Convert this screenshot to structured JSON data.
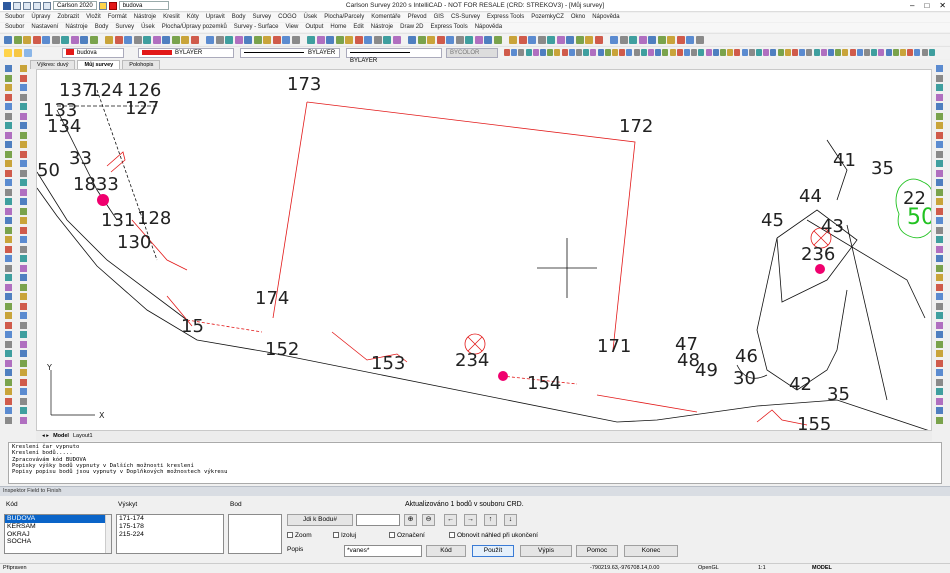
{
  "title": "Carlson Survey 2020 s IntelliCAD - NOT FOR RESALE (CRD: STREKOV3) - [Můj survey]",
  "quick_access": {
    "profile": "Carlson 2020",
    "layer": "budova"
  },
  "menu1": [
    "Soubor",
    "Úpravy",
    "Zobrazit",
    "Vložit",
    "Formát",
    "Nástroje",
    "Kreslit",
    "Kóty",
    "Upravit",
    "Body",
    "Survey",
    "COGO",
    "Úsek",
    "Plocha/Parcely",
    "Komentáře",
    "Převod",
    "GIS",
    "CS-Survey",
    "Express Tools",
    "PozemkyCZ",
    "Okno",
    "Nápověda"
  ],
  "menu2": [
    "Soubor",
    "Nastavení",
    "Nástroje",
    "Body",
    "Survey",
    "Úsek",
    "Plocha/Úpravy pozemků",
    "Survey - Surface",
    "View",
    "Output",
    "Home",
    "Edit",
    "Nástroje",
    "Draw 2D",
    "Express Tools",
    "Nápověda"
  ],
  "props": {
    "color_name": "BYLAYER",
    "linetype": "BYLAYER",
    "lineweight": "BYLAYER",
    "plotstyle": "BYCOLOR",
    "layer": "budova"
  },
  "doc_tabs": [
    "Výkres: duvý",
    "Můj survey",
    "Polohopis"
  ],
  "layout_tabs": [
    "Model",
    "Layout1"
  ],
  "drawing_labels": [
    {
      "id": "173",
      "t": "173"
    },
    {
      "id": "172",
      "t": "172"
    },
    {
      "id": "174",
      "t": "174"
    },
    {
      "id": "171",
      "t": "171"
    },
    {
      "id": "152",
      "t": "152"
    },
    {
      "id": "153",
      "t": "153"
    },
    {
      "id": "154",
      "t": "154"
    },
    {
      "id": "155",
      "t": "155"
    },
    {
      "id": "234",
      "t": "234"
    },
    {
      "id": "15",
      "t": "15"
    },
    {
      "id": "131",
      "t": "131"
    },
    {
      "id": "128",
      "t": "128"
    },
    {
      "id": "130",
      "t": "130"
    },
    {
      "id": "133",
      "t": "133"
    },
    {
      "id": "134",
      "t": "134"
    },
    {
      "id": "50",
      "t": "50"
    },
    {
      "id": "33",
      "t": "33"
    },
    {
      "id": "1833",
      "t": "1833"
    },
    {
      "id": "127",
      "t": "127"
    },
    {
      "id": "124",
      "t": "124"
    },
    {
      "id": "126",
      "t": "126"
    },
    {
      "id": "137",
      "t": "137"
    },
    {
      "id": "44",
      "t": "44"
    },
    {
      "id": "45",
      "t": "45"
    },
    {
      "id": "43",
      "t": "43"
    },
    {
      "id": "236",
      "t": "236"
    },
    {
      "id": "35",
      "t": "35"
    },
    {
      "id": "35b",
      "t": "35"
    },
    {
      "id": "47",
      "t": "47"
    },
    {
      "id": "48",
      "t": "48"
    },
    {
      "id": "49",
      "t": "49"
    },
    {
      "id": "46",
      "t": "46"
    },
    {
      "id": "30",
      "t": "30"
    },
    {
      "id": "42",
      "t": "42"
    },
    {
      "id": "41",
      "t": "41"
    },
    {
      "id": "22",
      "t": "22"
    },
    {
      "id": "50g",
      "t": "50"
    },
    {
      "id": "axisY",
      "t": "Y"
    },
    {
      "id": "axisX",
      "t": "X"
    }
  ],
  "command_lines": [
    "Kreslení čar vypnuto",
    "Kreslení bodů.....",
    "Zpracovávám kód BUDOVA",
    "Popisky výšky bodů vypnuty v Dalších možnosti kreslení",
    "Popisy popisu bodů jsou vypnuty v Doplňkových možnostech výkresu"
  ],
  "inspector": {
    "panel_title": "Inspektor Field to Finish",
    "col_kod": "Kód",
    "col_vyskyt": "Výskyt",
    "col_bod": "Bod",
    "codes": [
      "BUDOVA",
      "KERSAM",
      "OKRAJ",
      "SOCHA"
    ],
    "occurrences": [
      "171-174",
      "175-178",
      "215-224"
    ],
    "status": "Aktualizováno 1 bodů v souboru CRD.",
    "goto_button": "Jdi k Bodu#",
    "goto_value": "",
    "chk_zoom": "Zoom",
    "chk_izoluj": "Izoluj",
    "chk_oznaceni": "Označení",
    "chk_obnovit": "Obnovit náhled při ukončení",
    "popis_label": "Popis",
    "popis_value": "*vanes*",
    "btn_kod": "Kód",
    "btn_pouzij": "Použít",
    "btn_vypis": "Výpis",
    "btn_pomoc": "Pomoc",
    "btn_konec": "Konec"
  },
  "status": {
    "left": "Připraven",
    "coords": "-790219.63,-976708.14,0.00",
    "opengl": "OpenGL",
    "scale": "1:1",
    "mode": "MODEL"
  },
  "colors": {
    "accent": "#e21818",
    "point": "#f0006e",
    "selection": "#0a64c8",
    "green_label": "#21c221"
  }
}
